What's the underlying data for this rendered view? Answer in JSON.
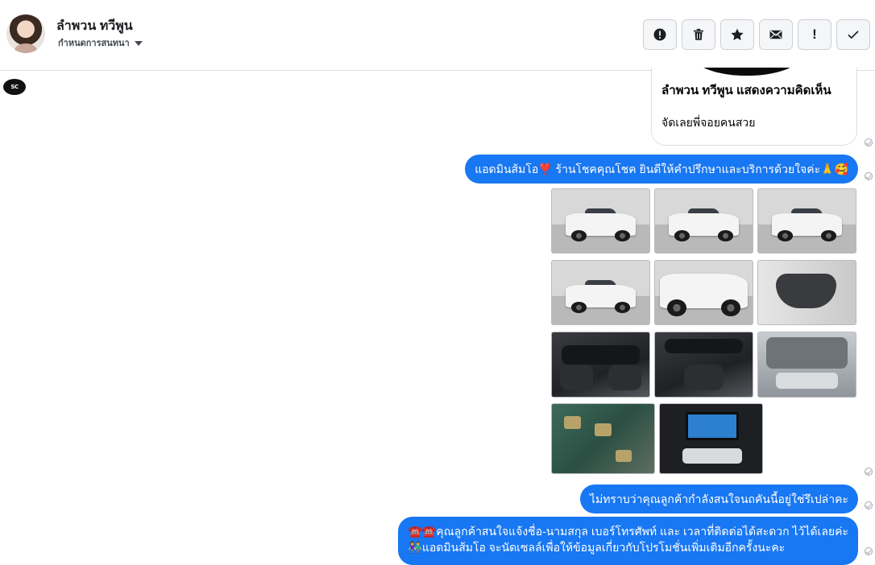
{
  "header": {
    "contact_name": "ลำพวน ทวีพูน",
    "assign_label": "กำหนดการสนทนา",
    "actions": [
      {
        "icon": "alert-circle-icon",
        "name": "spam-button"
      },
      {
        "icon": "trash-icon",
        "name": "delete-button"
      },
      {
        "icon": "star-icon",
        "name": "star-button"
      },
      {
        "icon": "envelope-icon",
        "name": "mark-unread-button"
      },
      {
        "icon": "exclamation-icon",
        "name": "follow-up-button"
      },
      {
        "icon": "checkmark-icon",
        "name": "done-button"
      }
    ]
  },
  "page_logo_text": "SC",
  "comment_card": {
    "title": "ลำพวน ทวีพูน แสดงความคิดเห็น",
    "text": "จัดเลยพี่จอยคนสวย"
  },
  "messages": [
    {
      "text": "แอดมินส้มโอ❣️ ร้านโชคคุณโชค ยินดีให้คำปรึกษาและบริการด้วยใจค่ะ🙏🥰"
    },
    {
      "text": "ไม่ทราบว่าคุณลูกค้ากำลังสนใจนถคันนี้อยู่ใช่รึเปล่าคะ"
    },
    {
      "line1": "☎️☎️คุณลูกค้าสนใจแจ้งชื่อ-นามสกุล เบอร์โทรศัพท์ และ เวลาที่ติดต่อได้สะดวก ไว้ได้เลยค่ะ",
      "line2": "👫แอดมินส้มโอ จะนัดเซลล์เพื่อให้ข้อมูลเกี่ยวกับโปรโมชั่นเพิ่มเติมอีกครั้งนะคะ"
    }
  ],
  "photos": [
    {
      "kind": "studio",
      "subject": "rear-view"
    },
    {
      "kind": "studio",
      "subject": "rear-view"
    },
    {
      "kind": "studio",
      "subject": "side-view"
    },
    {
      "kind": "studio",
      "subject": "side-view"
    },
    {
      "kind": "studio",
      "subject": "wheel"
    },
    {
      "kind": "door",
      "subject": "door-panel"
    },
    {
      "kind": "interior",
      "subject": "dashboard"
    },
    {
      "kind": "interior",
      "subject": "gear-shift"
    },
    {
      "kind": "engine",
      "subject": "front-grille"
    },
    {
      "kind": "battery",
      "subject": "battery"
    },
    {
      "kind": "radio",
      "subject": "head-unit"
    }
  ],
  "colors": {
    "bubble": "#1877f2",
    "border": "#dddfe2"
  }
}
